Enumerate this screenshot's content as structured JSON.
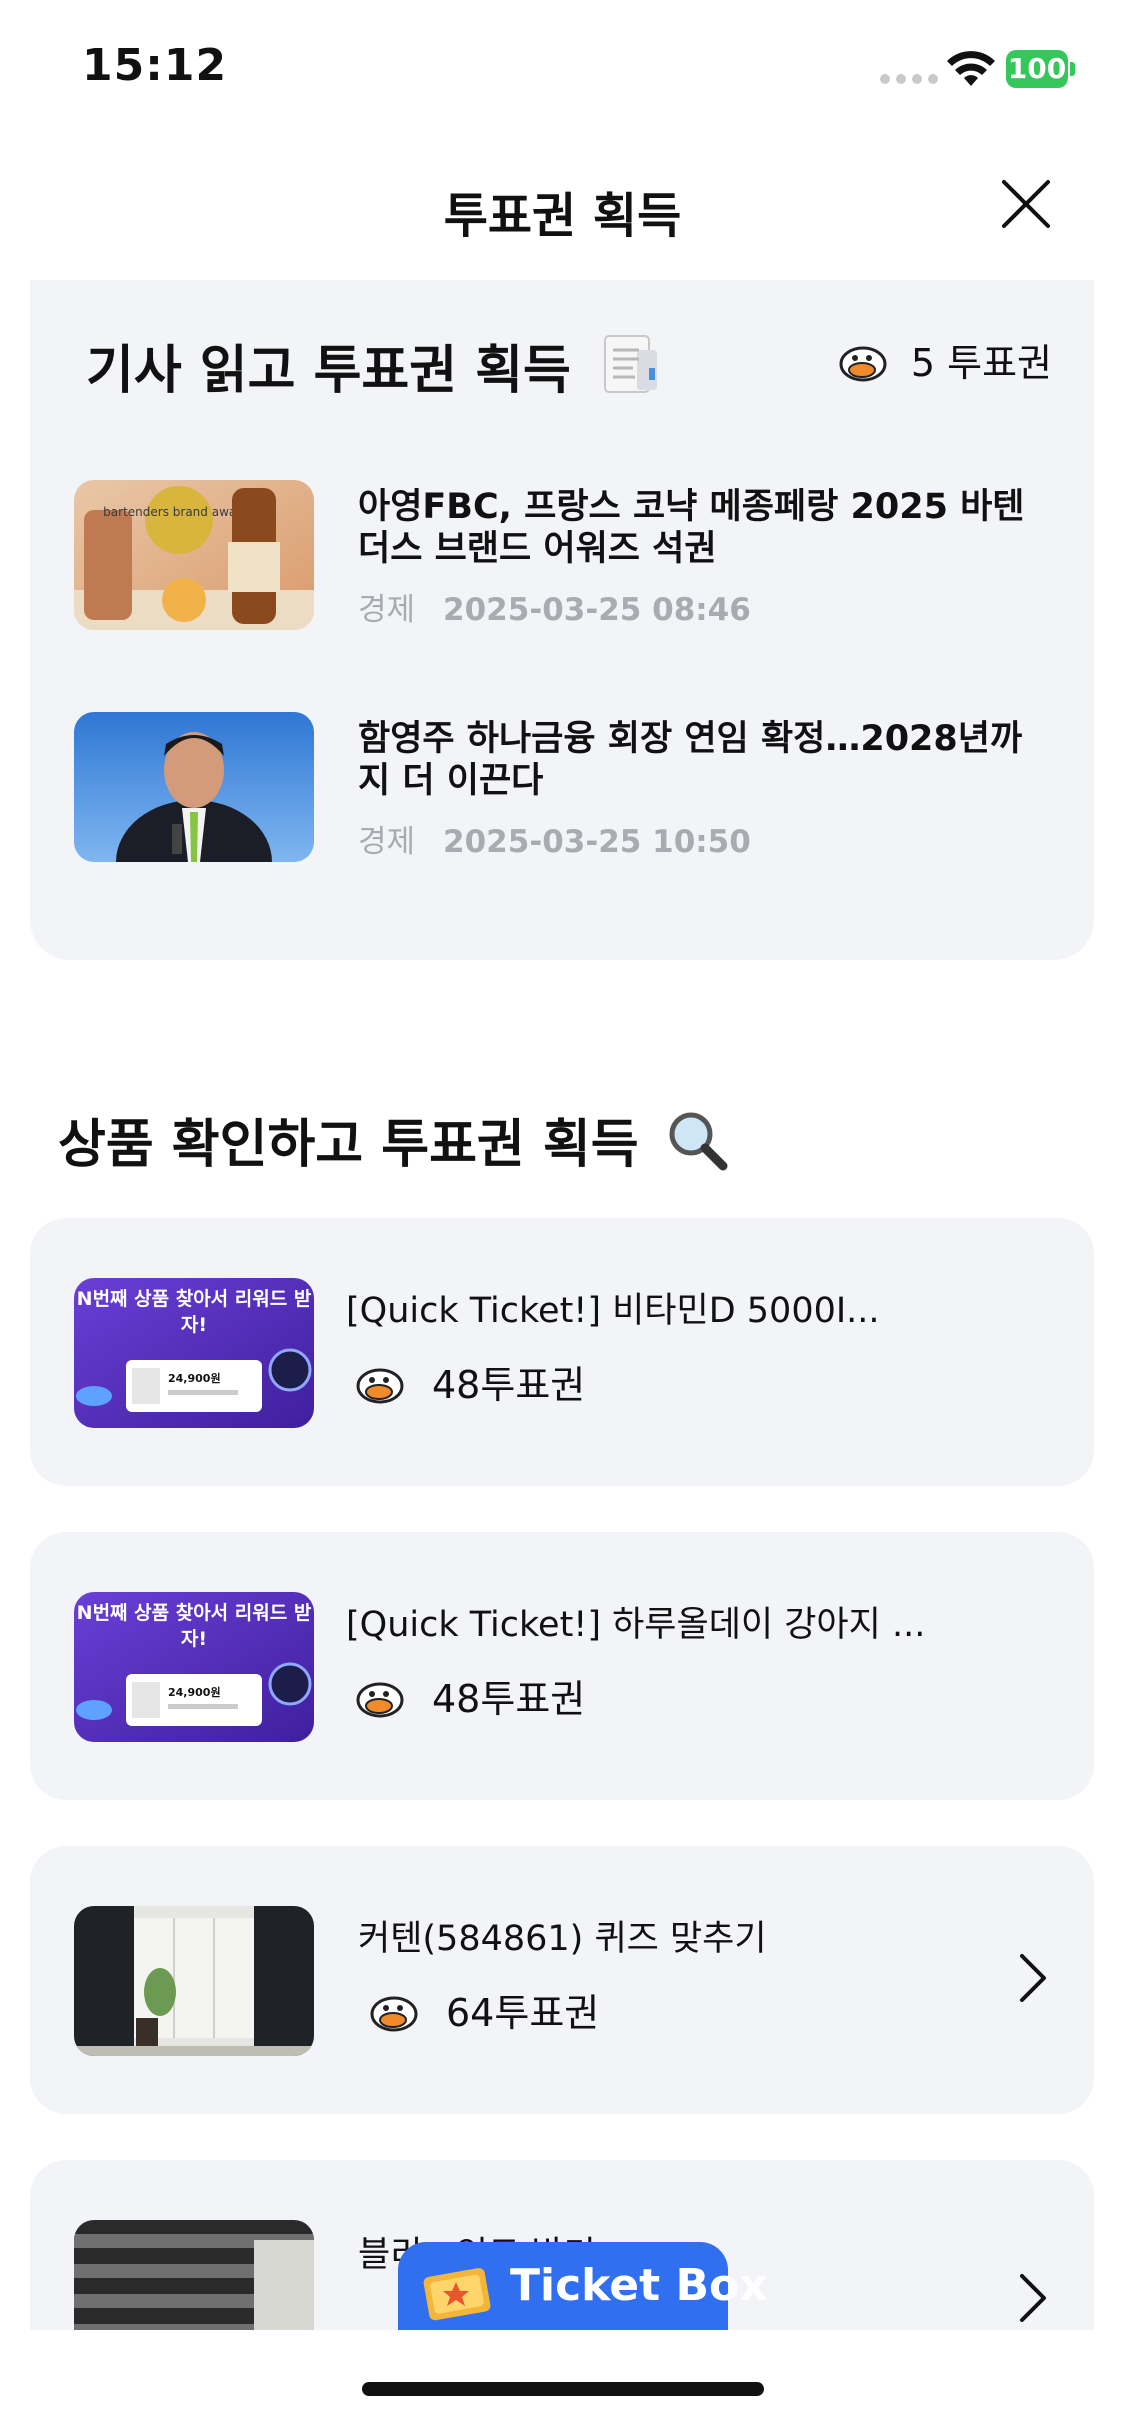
{
  "status_bar": {
    "time": "15:12",
    "battery": "100"
  },
  "header": {
    "title": "투표권 획득"
  },
  "articles_section": {
    "title": "기사 읽고 투표권 획득",
    "reward_label": "5 투표권",
    "items": [
      {
        "title": "아영FBC, 프랑스 코냑 메종페랑 2025 바텐더스 브랜드 어워즈 석권",
        "category": "경제",
        "datetime": "2025-03-25 08:46"
      },
      {
        "title": "함영주 하나금융 회장 연임 확정…2028년까지 더 이끈다",
        "category": "경제",
        "datetime": "2025-03-25 10:50"
      }
    ]
  },
  "products_section": {
    "title": "상품 확인하고 투표권 획득",
    "items": [
      {
        "title": "[Quick Ticket!] 비타민D 5000I...",
        "reward": "48투표권",
        "thumb_text": "N번째 상품 찾아서 리워드 받자!",
        "price": "24,900원"
      },
      {
        "title": "[Quick Ticket!] 하루올데이 강아지 ...",
        "reward": "48투표권",
        "thumb_text": "N번째 상품 찾아서 리워드 받자!",
        "price": "24,900원"
      },
      {
        "title": "커텐(584861) 퀴즈 맞추기",
        "reward": "64투표권"
      },
      {
        "title": "블리...인트 받기",
        "reward": ""
      }
    ]
  },
  "fab": {
    "label": "Ticket Box"
  },
  "thumb_badge": "bartenders brand awards",
  "colors": {
    "card_bg": "#f3f4f8",
    "fab_blue": "#2f6ff0",
    "meta_gray": "#a9abb0",
    "battery_green": "#35c759"
  },
  "icons": [
    "wifi-icon",
    "close-icon",
    "duck-icon",
    "chevron-right-icon",
    "document-icon",
    "magnifier-icon",
    "ticket-icon"
  ]
}
